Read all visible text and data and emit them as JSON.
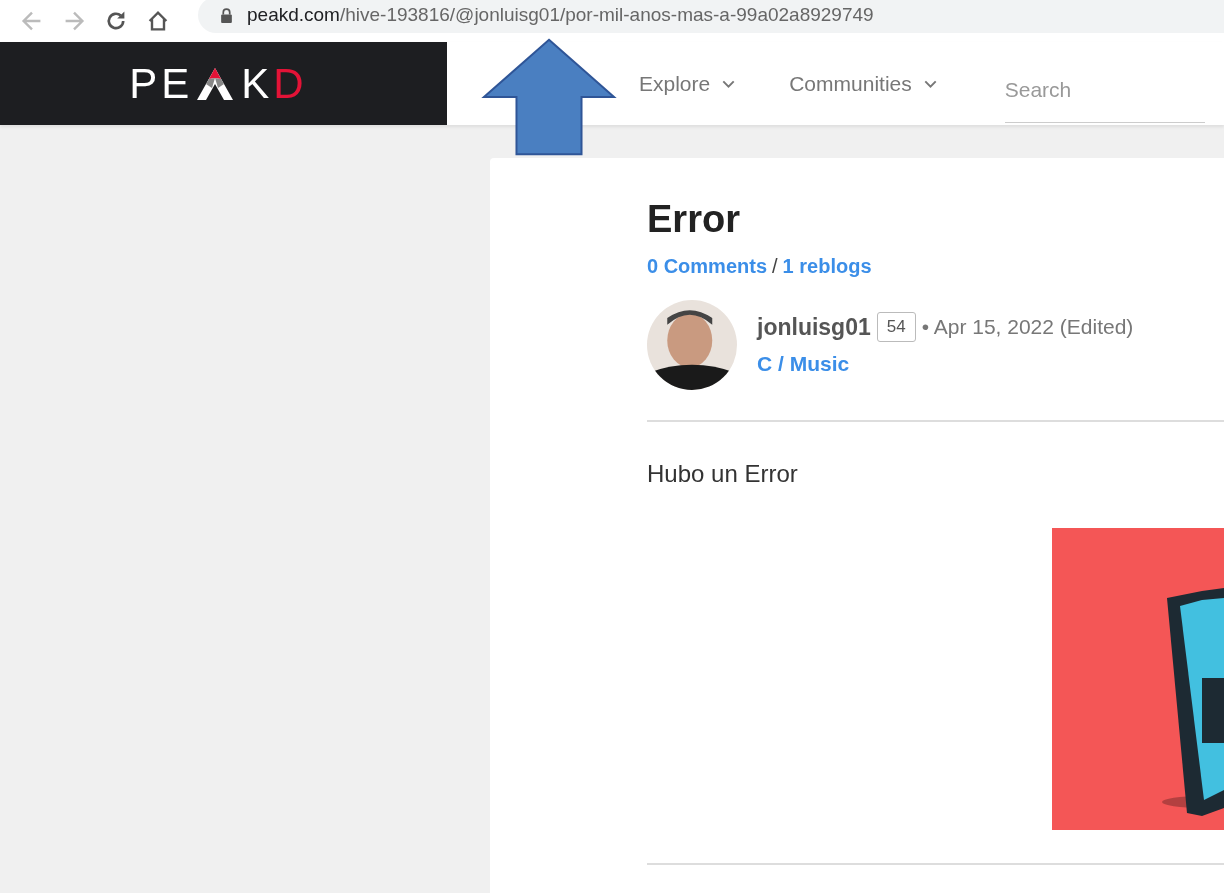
{
  "browser": {
    "url_host": "peakd.com",
    "url_path": "/hive-193816/@jonluisg01/por-mil-anos-mas-a-99a02a8929749"
  },
  "logo": {
    "start": "PE",
    "middle": "K",
    "accent": "D"
  },
  "nav": [
    {
      "label": "Explore"
    },
    {
      "label": "Communities"
    }
  ],
  "search": {
    "placeholder": "Search"
  },
  "post": {
    "title": "Error",
    "comments": "0 Comments",
    "separator": "/",
    "reblogs": "1 reblogs",
    "author": "jonluisg01",
    "reputation": "54",
    "date": "• Apr 15, 2022 (Edited)",
    "community": "C / Music",
    "body": "Hubo un Error"
  }
}
